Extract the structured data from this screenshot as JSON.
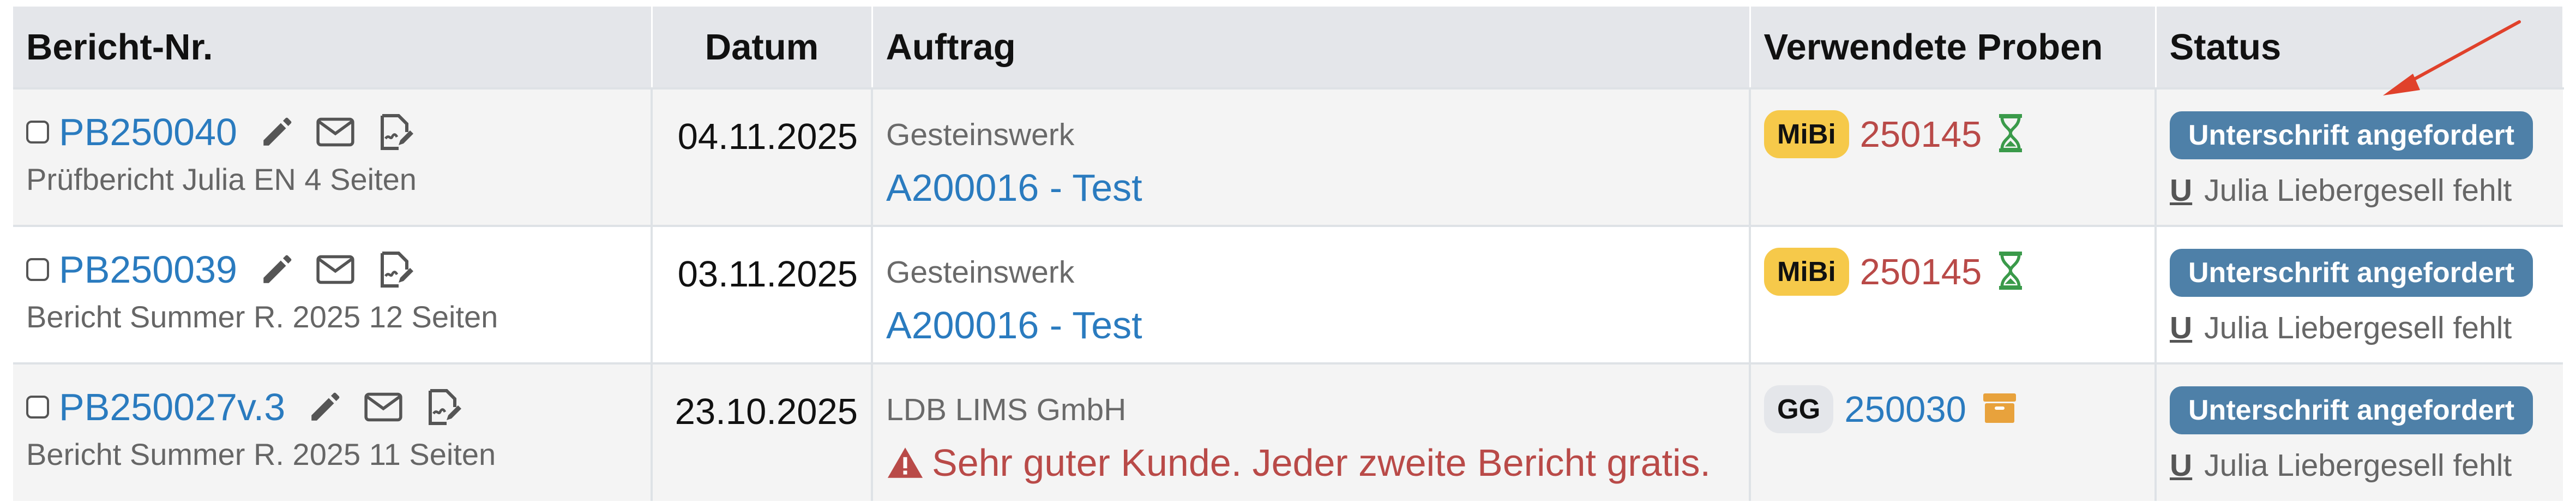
{
  "table": {
    "headers": {
      "bericht": "Bericht-Nr.",
      "datum": "Datum",
      "auftrag": "Auftrag",
      "proben": "Verwendete Proben",
      "status": "Status"
    },
    "rows": [
      {
        "report_no": "PB250040",
        "subtitle": "Prüfbericht Julia EN 4 Seiten",
        "date": "04.11.2025",
        "client": "Gesteinswerk",
        "order_link": "A200016 - Test",
        "warning": "",
        "sample_badge": "MiBi",
        "sample_number": "250145",
        "sample_icon": "hourglass-icon",
        "status_button": "Unterschrift angefordert",
        "status_missing_icon": "U",
        "status_missing": "Julia Liebergesell fehlt"
      },
      {
        "report_no": "PB250039",
        "subtitle": "Bericht Summer R. 2025 12 Seiten",
        "date": "03.11.2025",
        "client": "Gesteinswerk",
        "order_link": "A200016 - Test",
        "warning": "",
        "sample_badge": "MiBi",
        "sample_number": "250145",
        "sample_icon": "hourglass-icon",
        "status_button": "Unterschrift angefordert",
        "status_missing_icon": "U",
        "status_missing": "Julia Liebergesell fehlt"
      },
      {
        "report_no": "PB250027v.3",
        "subtitle": "Bericht Summer R. 2025 11 Seiten",
        "date": "23.10.2025",
        "client": "LDB LIMS GmbH",
        "order_link": "",
        "warning": "Sehr guter Kunde. Jeder zweite Bericht gratis.",
        "sample_badge": "GG",
        "sample_number": "250030",
        "sample_icon": "archive-box-icon",
        "status_button": "Unterschrift angefordert",
        "status_missing_icon": "U",
        "status_missing": "Julia Liebergesell fehlt"
      }
    ]
  },
  "colors": {
    "link_blue": "#2a7bbf",
    "sample_red": "#b94a48",
    "mibi_yellow": "#f6c94a",
    "status_blue": "#4e80a8",
    "annotation_arrow": "#e0412b"
  }
}
